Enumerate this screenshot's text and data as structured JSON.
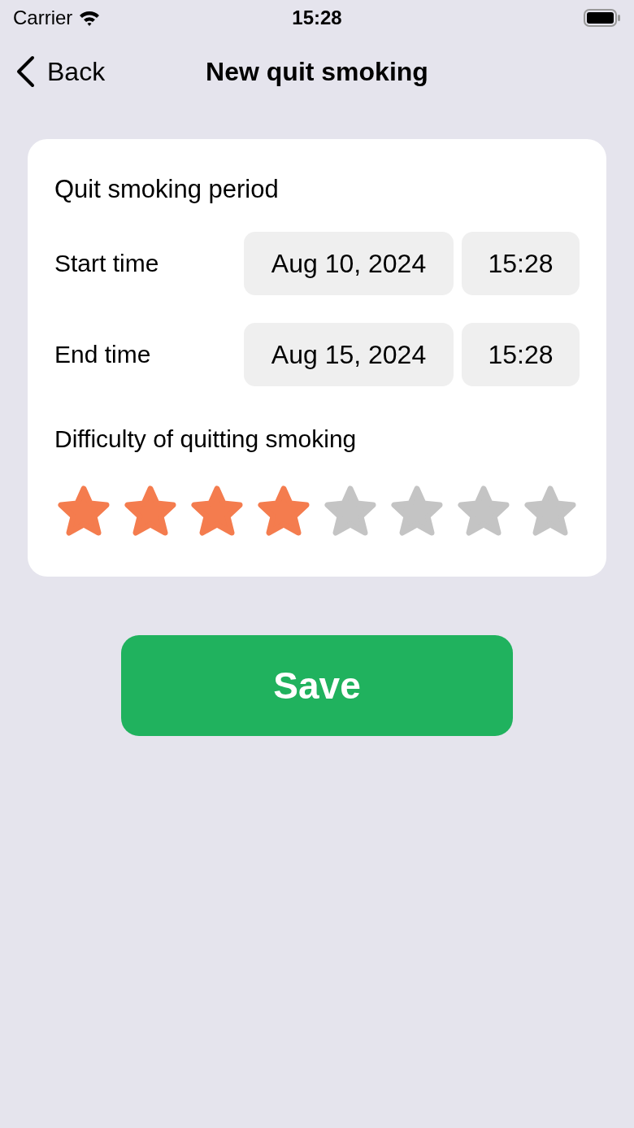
{
  "status_bar": {
    "carrier": "Carrier",
    "time": "15:28"
  },
  "nav": {
    "back": "Back",
    "title": "New quit smoking"
  },
  "card": {
    "title": "Quit smoking period",
    "rows": [
      {
        "label": "Start time",
        "date": "Aug 10, 2024",
        "time": "15:28"
      },
      {
        "label": "End time",
        "date": "Aug 15, 2024",
        "time": "15:28"
      }
    ],
    "difficulty": {
      "label": "Difficulty of quitting smoking",
      "stars": 4
    }
  },
  "save_button": "Save"
}
